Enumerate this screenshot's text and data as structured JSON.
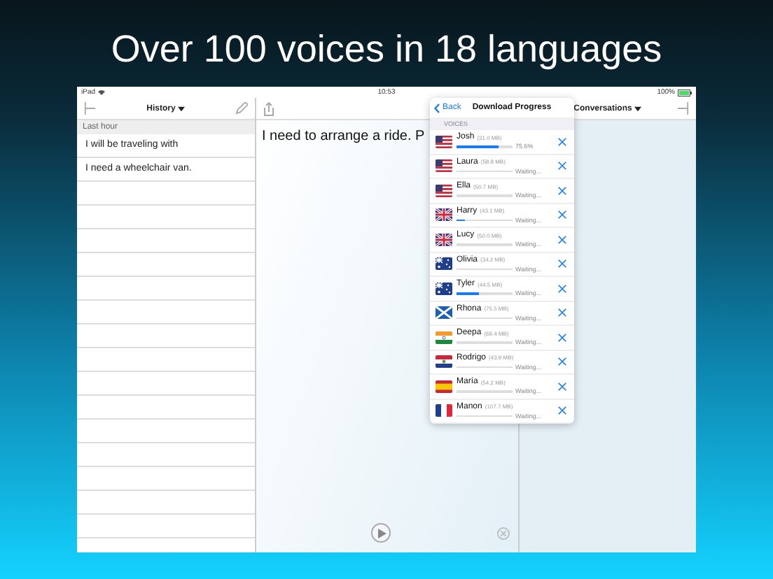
{
  "headline": "Over 100 voices in 18 languages",
  "status_bar": {
    "device": "iPad",
    "time": "10:53",
    "battery": "100%"
  },
  "history": {
    "title": "History",
    "section": "Last hour",
    "items": [
      "I will be traveling with",
      "I need a wheelchair van."
    ]
  },
  "main": {
    "text": "I need to arrange a ride. P"
  },
  "conversations": {
    "title": "Conversations"
  },
  "popover": {
    "back": "Back",
    "title": "Download Progress",
    "section": "VOICES",
    "voices": [
      {
        "name": "Josh",
        "size": "(31.0 MB)",
        "level": 0.756,
        "status": "75.6%",
        "kind": "us"
      },
      {
        "name": "Laura",
        "size": "(58.8 MB)",
        "level": 0,
        "status": "Waiting...",
        "kind": "us"
      },
      {
        "name": "Ella",
        "size": "(50.7 MB)",
        "level": 0,
        "status": "Waiting...",
        "kind": "us"
      },
      {
        "name": "Harry",
        "size": "(43.1 MB)",
        "level": 0.15,
        "status": "Waiting...",
        "kind": "uk"
      },
      {
        "name": "Lucy",
        "size": "(50.0 MB)",
        "level": 0,
        "status": "Waiting...",
        "kind": "uk"
      },
      {
        "name": "Olivia",
        "size": "(34.2 MB)",
        "level": 0,
        "status": "Waiting...",
        "kind": "au"
      },
      {
        "name": "Tyler",
        "size": "(44.5 MB)",
        "level": 0.4,
        "status": "Waiting...",
        "kind": "au"
      },
      {
        "name": "Rhona",
        "size": "(75.5 MB)",
        "level": 0,
        "status": "Waiting...",
        "kind": "scotland"
      },
      {
        "name": "Deepa",
        "size": "(69.4 MB)",
        "level": 0,
        "status": "Waiting...",
        "kind": "in"
      },
      {
        "name": "Rodrigo",
        "size": "(43.9 MB)",
        "level": 0,
        "status": "Waiting...",
        "kind": "rwb"
      },
      {
        "name": "María",
        "size": "(54.2 MB)",
        "level": 0,
        "status": "Waiting...",
        "kind": "es"
      },
      {
        "name": "Manon",
        "size": "(107.7 MB)",
        "level": 0,
        "status": "Waiting...",
        "kind": "fr"
      }
    ]
  }
}
